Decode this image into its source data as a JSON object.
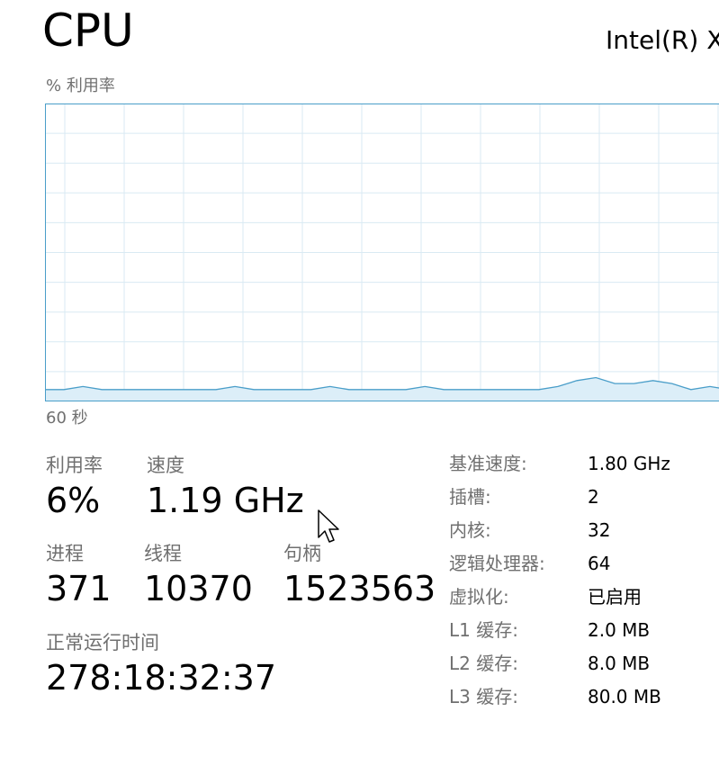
{
  "header": {
    "title": "CPU",
    "cpu_name": "Intel(R) X"
  },
  "graph": {
    "y_label": "% 利用率",
    "time_span_label": "60 秒",
    "line_color": "#4a9ec9",
    "fill_color": "#dceef8",
    "border_color": "#4a9ec9",
    "grid_color": "#d9eaf3",
    "usage_history_percent": [
      4,
      4,
      5,
      4,
      4,
      4,
      4,
      4,
      4,
      4,
      5,
      4,
      4,
      4,
      4,
      5,
      4,
      4,
      4,
      4,
      5,
      4,
      4,
      4,
      4,
      4,
      4,
      5,
      7,
      8,
      6,
      6,
      7,
      6,
      4,
      5,
      4
    ]
  },
  "stats": {
    "utilization": {
      "label": "利用率",
      "value": "6%"
    },
    "speed": {
      "label": "速度",
      "value": "1.19 GHz"
    },
    "processes": {
      "label": "进程",
      "value": "371"
    },
    "threads": {
      "label": "线程",
      "value": "10370"
    },
    "handles": {
      "label": "句柄",
      "value": "1523563"
    },
    "uptime": {
      "label": "正常运行时间",
      "value": "278:18:32:37"
    }
  },
  "specs": [
    {
      "label": "基准速度:",
      "value": "1.80 GHz"
    },
    {
      "label": "插槽:",
      "value": "2"
    },
    {
      "label": "内核:",
      "value": "32"
    },
    {
      "label": "逻辑处理器:",
      "value": "64"
    },
    {
      "label": "虚拟化:",
      "value": "已启用"
    },
    {
      "label": "L1 缓存:",
      "value": "2.0 MB"
    },
    {
      "label": "L2 缓存:",
      "value": "8.0 MB"
    },
    {
      "label": "L3 缓存:",
      "value": "80.0 MB"
    }
  ]
}
